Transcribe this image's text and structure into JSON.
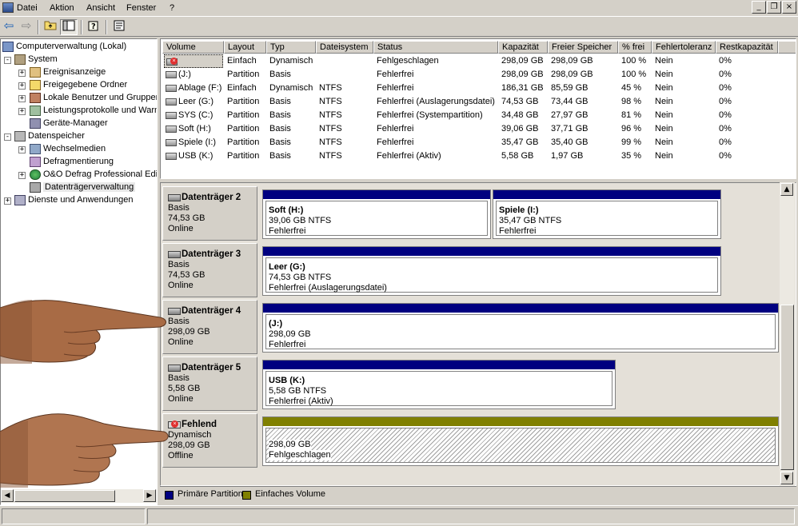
{
  "menu": {
    "items": [
      "Datei",
      "Aktion",
      "Ansicht",
      "Fenster",
      "?"
    ]
  },
  "window_buttons": {
    "minimize": "_",
    "restore": "❐",
    "close": "×"
  },
  "toolbar": {
    "back": "⇦",
    "forward": "⇨"
  },
  "tree": {
    "root": "Computerverwaltung (Lokal)",
    "system": "System",
    "system_children": [
      "Ereignisanzeige",
      "Freigegebene Ordner",
      "Lokale Benutzer und Gruppen",
      "Leistungsprotokolle und Warn",
      "Geräte-Manager"
    ],
    "storage": "Datenspeicher",
    "storage_children": [
      "Wechselmedien",
      "Defragmentierung",
      "O&O Defrag Professional Edi",
      "Datenträgerverwaltung"
    ],
    "services": "Dienste und Anwendungen"
  },
  "volume_list": {
    "headers": [
      "Volume",
      "Layout",
      "Typ",
      "Dateisystem",
      "Status",
      "Kapazität",
      "Freier Speicher",
      "% frei",
      "Fehlertoleranz",
      "Restkapazität"
    ],
    "rows": [
      [
        "",
        "Einfach",
        "Dynamisch",
        "",
        "Fehlgeschlagen",
        "298,09 GB",
        "298,09 GB",
        "100 %",
        "Nein",
        "0%"
      ],
      [
        "(J:)",
        "Partition",
        "Basis",
        "",
        "Fehlerfrei",
        "298,09 GB",
        "298,09 GB",
        "100 %",
        "Nein",
        "0%"
      ],
      [
        "Ablage (F:)",
        "Einfach",
        "Dynamisch",
        "NTFS",
        "Fehlerfrei",
        "186,31 GB",
        "85,59 GB",
        "45 %",
        "Nein",
        "0%"
      ],
      [
        "Leer (G:)",
        "Partition",
        "Basis",
        "NTFS",
        "Fehlerfrei (Auslagerungsdatei)",
        "74,53 GB",
        "73,44 GB",
        "98 %",
        "Nein",
        "0%"
      ],
      [
        "SYS (C:)",
        "Partition",
        "Basis",
        "NTFS",
        "Fehlerfrei (Systempartition)",
        "34,48 GB",
        "27,97 GB",
        "81 %",
        "Nein",
        "0%"
      ],
      [
        "Soft (H:)",
        "Partition",
        "Basis",
        "NTFS",
        "Fehlerfrei",
        "39,06 GB",
        "37,71 GB",
        "96 %",
        "Nein",
        "0%"
      ],
      [
        "Spiele (I:)",
        "Partition",
        "Basis",
        "NTFS",
        "Fehlerfrei",
        "35,47 GB",
        "35,40 GB",
        "99 %",
        "Nein",
        "0%"
      ],
      [
        "USB (K:)",
        "Partition",
        "Basis",
        "NTFS",
        "Fehlerfrei (Aktiv)",
        "5,58 GB",
        "1,97 GB",
        "35 %",
        "Nein",
        "0%"
      ]
    ]
  },
  "disks": [
    {
      "name": "Datenträger 2",
      "type": "Basis",
      "size": "74,53 GB",
      "state": "Online",
      "partitions": [
        {
          "name": "Soft  (H:)",
          "size": "39,06 GB NTFS",
          "status": "Fehlerfrei"
        },
        {
          "name": "Spiele  (I:)",
          "size": "35,47 GB NTFS",
          "status": "Fehlerfrei"
        }
      ]
    },
    {
      "name": "Datenträger 3",
      "type": "Basis",
      "size": "74,53 GB",
      "state": "Online",
      "partitions": [
        {
          "name": "Leer  (G:)",
          "size": "74,53 GB NTFS",
          "status": "Fehlerfrei (Auslagerungsdatei)"
        }
      ]
    },
    {
      "name": "Datenträger 4",
      "type": "Basis",
      "size": "298,09 GB",
      "state": "Online",
      "partitions": [
        {
          "name": "(J:)",
          "size": "298,09 GB",
          "status": "Fehlerfrei"
        }
      ]
    },
    {
      "name": "Datenträger 5",
      "type": "Basis",
      "size": "5,58 GB",
      "state": "Online",
      "partitions": [
        {
          "name": "USB  (K:)",
          "size": "5,58 GB NTFS",
          "status": "Fehlerfrei (Aktiv)"
        }
      ]
    },
    {
      "name": "Fehlend",
      "type": "Dynamisch",
      "size": "298,09 GB",
      "state": "Offline",
      "partitions": [
        {
          "name": "",
          "size": "298,09 GB",
          "status": "Fehlgeschlagen"
        }
      ]
    }
  ],
  "legend": {
    "primary": "Primäre Partition",
    "simple": "Einfaches Volume"
  },
  "colors": {
    "primary": "#000080",
    "simple": "#808000",
    "selected": "#0a246a"
  }
}
